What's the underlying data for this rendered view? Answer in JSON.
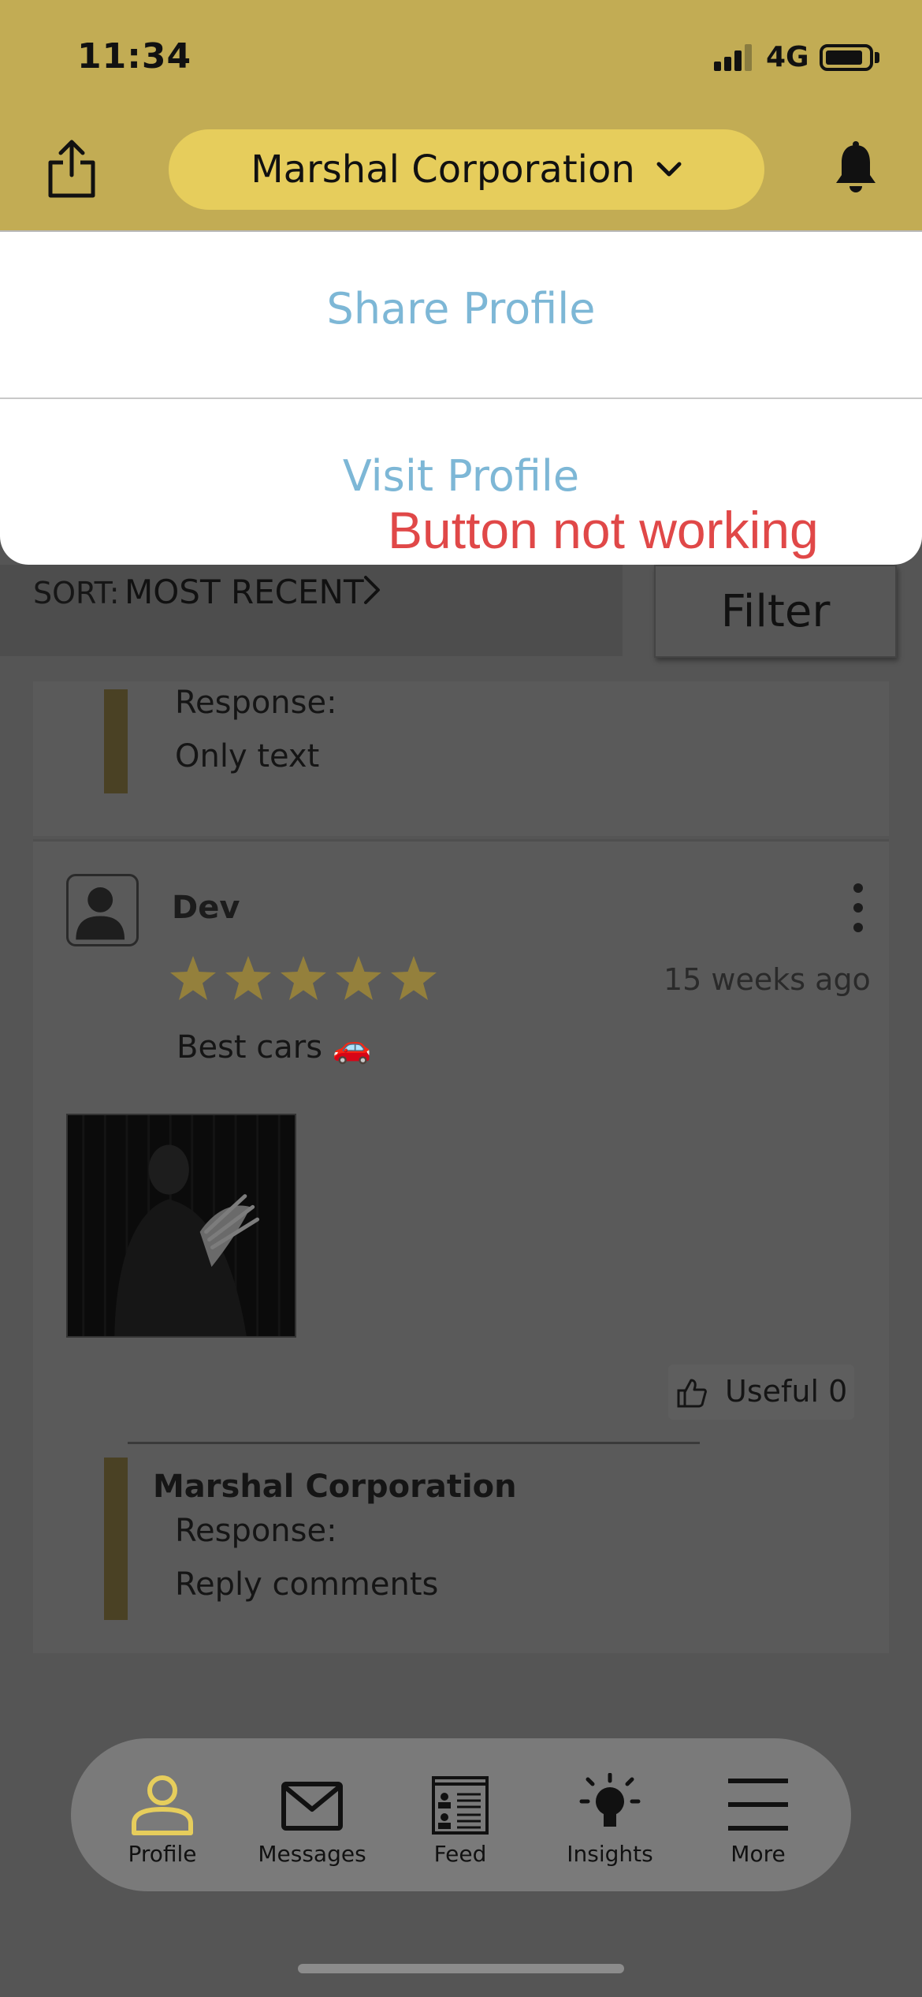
{
  "status_bar": {
    "time": "11:34",
    "network": "4G"
  },
  "header": {
    "company_name": "Marshal Corporation"
  },
  "action_sheet": {
    "items": [
      {
        "label": "Share Profile"
      },
      {
        "label": "Visit Profile"
      }
    ],
    "annotation": "Button not working"
  },
  "sort": {
    "label": "SORT:",
    "value": "MOST RECENT",
    "filter_label": "Filter"
  },
  "review_previous": {
    "response_label": "Response:",
    "response_text": "Only text"
  },
  "review": {
    "reviewer_name": "Dev",
    "rating": 5,
    "rating_max": 5,
    "time_ago": "15 weeks ago",
    "text": "Best cars 🚗",
    "useful_label": "Useful 0",
    "reply": {
      "company": "Marshal Corporation",
      "response_label": "Response:",
      "response_text": "Reply comments"
    }
  },
  "tabbar": {
    "tabs": [
      {
        "label": "Profile",
        "icon": "person-icon",
        "active": true
      },
      {
        "label": "Messages",
        "icon": "envelope-icon",
        "active": false
      },
      {
        "label": "Feed",
        "icon": "feed-icon",
        "active": false
      },
      {
        "label": "Insights",
        "icon": "lightbulb-icon",
        "active": false
      },
      {
        "label": "More",
        "icon": "hamburger-icon",
        "active": false
      }
    ]
  },
  "colors": {
    "header_bg": "#c2ac54",
    "pill_bg": "#e6cd5c",
    "link": "#7db7d6",
    "annotation": "#e04848",
    "active_tab": "#e6cd5c",
    "star": "#94803c"
  }
}
